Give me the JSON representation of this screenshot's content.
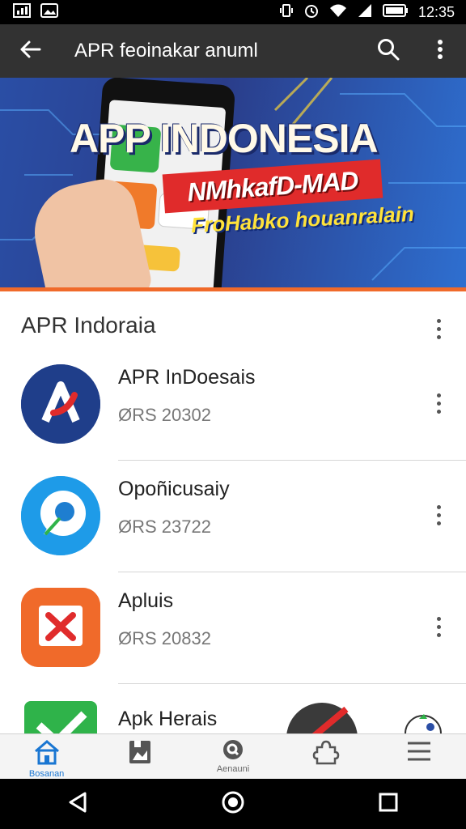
{
  "status_bar": {
    "time": "12:35",
    "icons": [
      "gallery-notification-icon",
      "image-notification-icon",
      "vibrate-icon",
      "alarm-icon",
      "wifi-icon",
      "signal-icon",
      "battery-icon"
    ]
  },
  "app_bar": {
    "title": "APR feoinakar anuml",
    "back_icon": "arrow-left-icon",
    "search_icon": "search-icon",
    "overflow_icon": "more-vertical-icon"
  },
  "banner": {
    "title": "APP INDONESIA",
    "ribbon": "NMhkafD-MAD",
    "subtitle": "FroHabko houanralain",
    "colors": {
      "background": "#2a4ea5",
      "ribbon": "#e02b2b",
      "stripe": "#f06a2a",
      "subtitle": "#ffe23a"
    }
  },
  "section": {
    "title": "APR Indoraia"
  },
  "apps": [
    {
      "name": "APR InDoesais",
      "meta": "ØRS 20302",
      "icon": "blue-logo-icon",
      "icon_color": "#1f3e8a"
    },
    {
      "name": "Opoñicusaiy",
      "meta": "ØRS 23722",
      "icon": "chat-bubble-icon",
      "icon_color": "#1e9be8"
    },
    {
      "name": "Apluis",
      "meta": "ØRS 20832",
      "icon": "x-badge-icon",
      "icon_color": "#f06a2a"
    },
    {
      "name": "Apk Herais",
      "meta": "",
      "icon": "checkmark-icon",
      "icon_color": "#2fb34a"
    }
  ],
  "bottom_nav": {
    "items": [
      {
        "label": "Bosanan",
        "icon": "home-icon",
        "active": true
      },
      {
        "label": "",
        "icon": "bookmark-icon",
        "active": false
      },
      {
        "label": "Aenauni",
        "icon": "search-badge-icon",
        "active": false
      },
      {
        "label": "",
        "icon": "puzzle-icon",
        "active": false
      },
      {
        "label": "",
        "icon": "menu-icon",
        "active": false
      }
    ]
  },
  "system_nav": {
    "icons": [
      "back-triangle-icon",
      "home-circle-icon",
      "recents-square-icon"
    ]
  }
}
